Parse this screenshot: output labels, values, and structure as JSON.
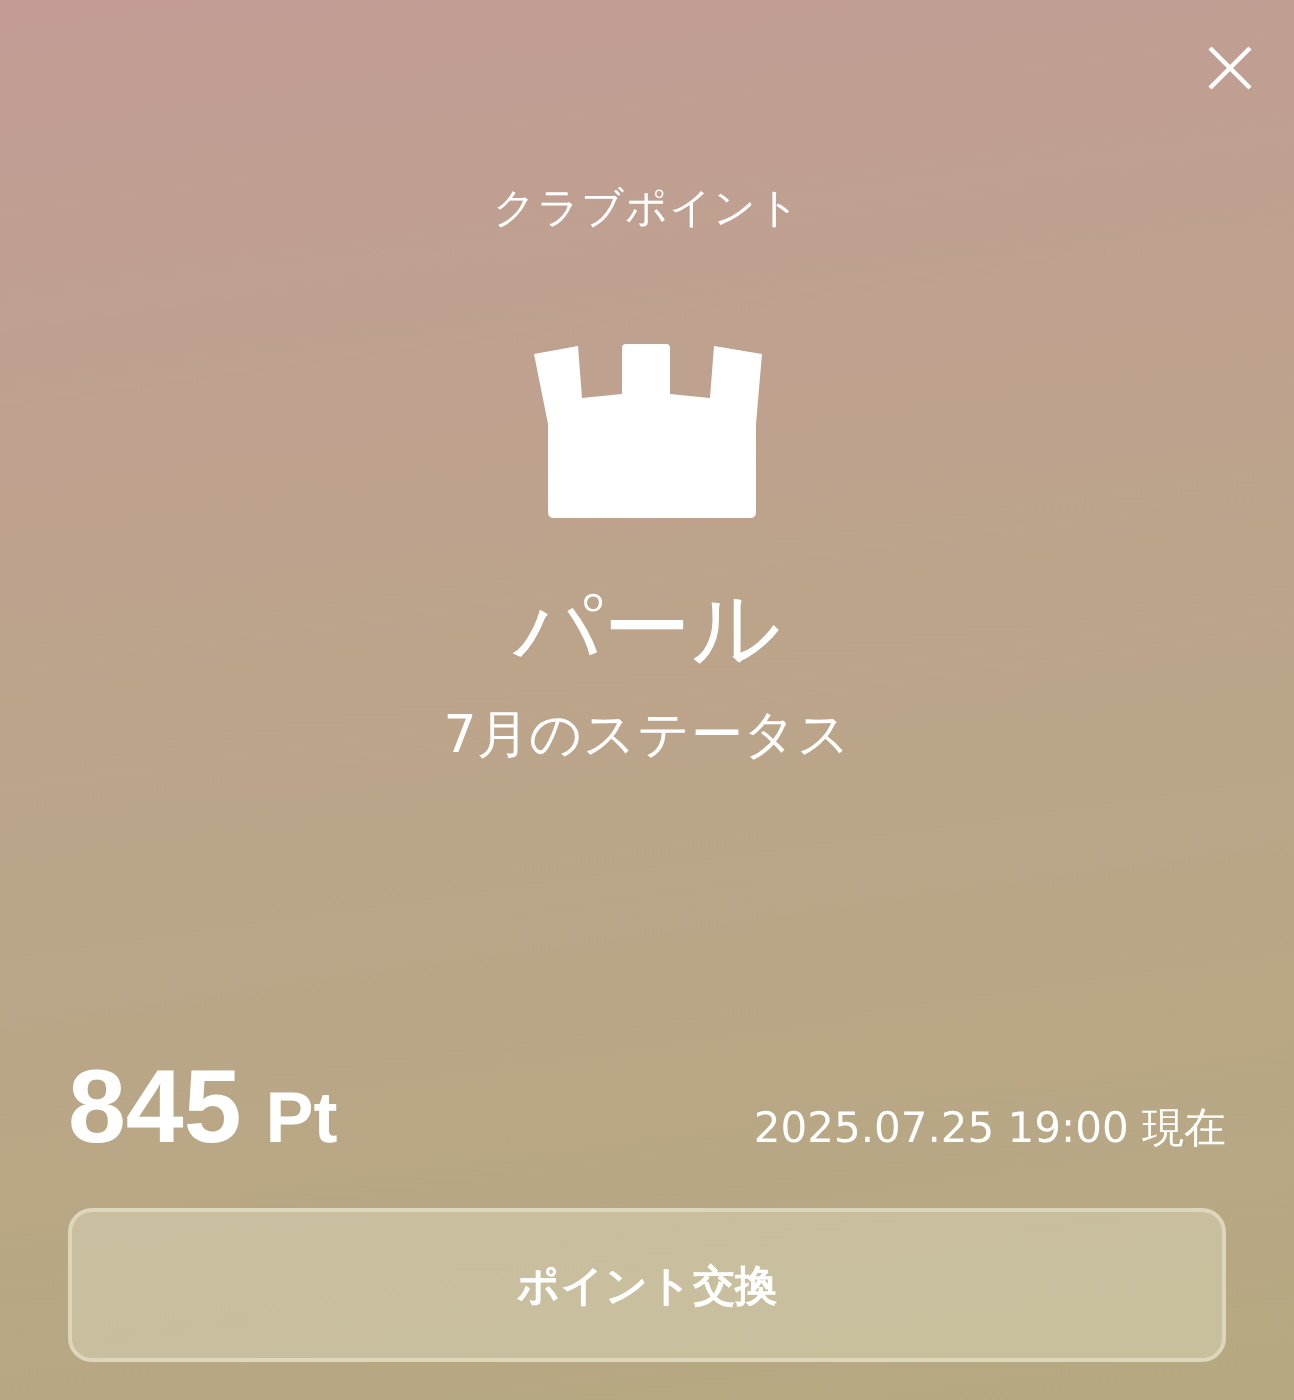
{
  "title": "クラブポイント",
  "status": {
    "rank": "パール",
    "caption": "7月のステータス"
  },
  "points": {
    "value": "845",
    "unit": "Pt",
    "as_of": "2025.07.25 19:00 現在"
  },
  "button": {
    "label": "ポイント交換"
  }
}
